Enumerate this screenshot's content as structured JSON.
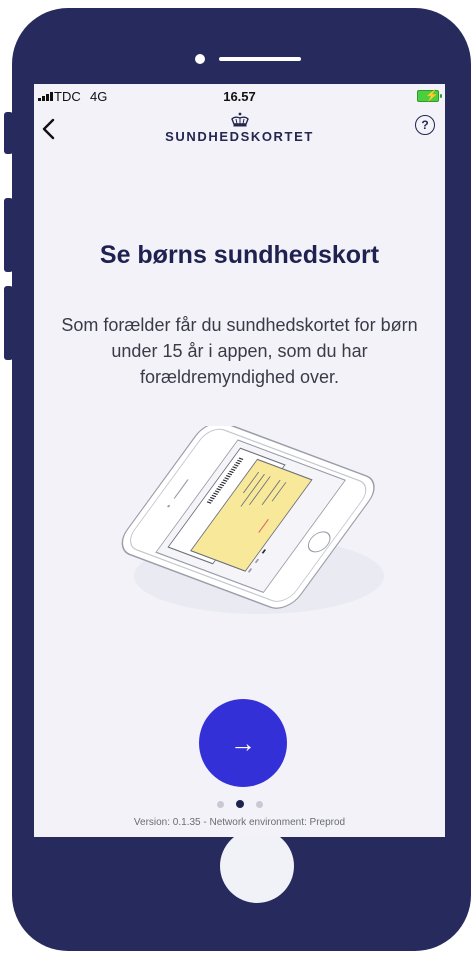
{
  "status_bar": {
    "carrier": "TDC",
    "network": "4G",
    "time": "16.57"
  },
  "nav": {
    "back_icon": "chevron-left-icon",
    "logo_icon": "crown-icon",
    "brand": "SUNDHEDSKORTET",
    "help_label": "?"
  },
  "main": {
    "title": "Se børns sundhedskort",
    "description": "Som forælder får du sundhedskortet for børn under 15 år i appen, som du har forældremyndighed over.",
    "illustration_icon": "phone-with-health-card-illustration"
  },
  "pager": {
    "next_label": "→",
    "current_page": 2,
    "total_pages": 3
  },
  "footer": {
    "version": "Version: 0.1.35 - Network environment: Preprod"
  },
  "colors": {
    "frame": "#262a5c",
    "screen_bg": "#f2f2f8",
    "accent": "#3430d7",
    "title": "#1f2150",
    "card_yellow": "#f8e99a"
  }
}
